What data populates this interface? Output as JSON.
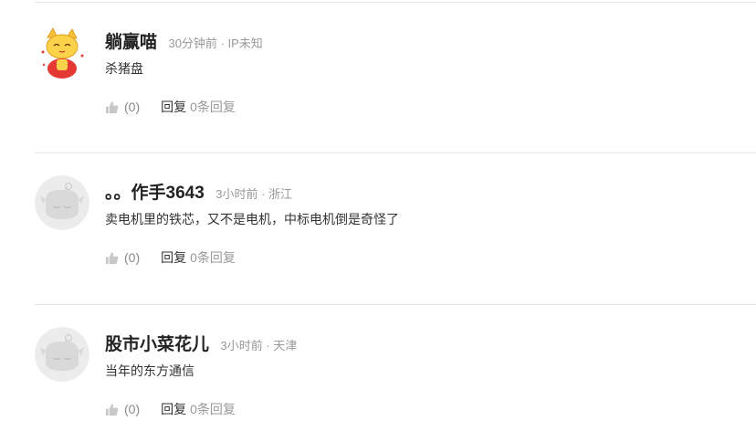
{
  "comments": [
    {
      "username": "躺赢喵",
      "meta": "30分钟前 · IP未知",
      "content": "杀猪盘",
      "like_count": "(0)",
      "reply_label": "回复",
      "reply_count": "0条回复",
      "avatar": "cartoon-cat-avatar"
    },
    {
      "username": "。。作手3643",
      "meta": "3小时前 · 浙江",
      "content": "卖电机里的铁芯，又不是电机，中标电机倒是奇怪了",
      "like_count": "(0)",
      "reply_label": "回复",
      "reply_count": "0条回复",
      "avatar": "default-gray-avatar"
    },
    {
      "username": "股市小菜花儿",
      "meta": "3小时前 · 天津",
      "content": "当年的东方通信",
      "like_count": "(0)",
      "reply_label": "回复",
      "reply_count": "0条回复",
      "avatar": "default-gray-avatar"
    }
  ],
  "icons": {
    "like": "thumbs-up-icon"
  },
  "colors": {
    "username": "#222222",
    "meta": "#999999",
    "divider": "#e6e6e6",
    "icon": "#c8c8c8"
  }
}
